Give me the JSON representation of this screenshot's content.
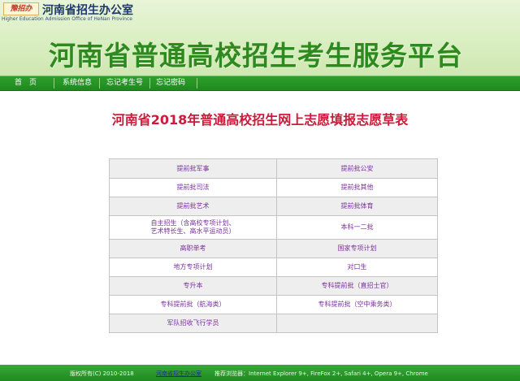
{
  "header": {
    "logo_text": "豫招办",
    "office_name": "河南省招生办公室",
    "office_en": "Higher Education Admission Office of HeNan Province",
    "site_title": "河南省普通高校招生考生服务平台"
  },
  "nav": {
    "items": [
      {
        "label": "首　页"
      },
      {
        "label": "系统信息"
      },
      {
        "label": "忘记考生号"
      },
      {
        "label": "忘记密码"
      }
    ]
  },
  "main": {
    "title": "河南省2018年普通高校招生网上志愿填报志愿草表"
  },
  "grid": {
    "rows": [
      {
        "left": "提前批军事",
        "right": "提前批公安"
      },
      {
        "left": "提前批司法",
        "right": "提前批其他"
      },
      {
        "left": "提前批艺术",
        "right": "提前批体育"
      },
      {
        "left": "自主招生（含高校专项计划、\n艺术特长生、高水平运动员）",
        "right": "本科一二批"
      },
      {
        "left": "高职单考",
        "right": "国家专项计划"
      },
      {
        "left": "地方专项计划",
        "right": "对口生"
      },
      {
        "left": "专升本",
        "right": "专科提前批（直招士官）"
      },
      {
        "left": "专科提前批（航海类）",
        "right": "专科提前批（空中乘务类）"
      },
      {
        "left": "军队招收飞行学员",
        "right": ""
      }
    ]
  },
  "footer": {
    "copyright": "版权所有(C) 2010-2018",
    "office_link": "河南省招生办公室",
    "browsers": "推荐浏览器：Internet Explorer 9+, FireFox 2+, Safari 4+, Opera 9+, Chrome"
  },
  "colors": {
    "title_green": "#2e8a1f",
    "nav_green": "#1f8a1f",
    "main_title_red": "#cc1b3a",
    "cell_text_purple": "#7b2fa0"
  }
}
